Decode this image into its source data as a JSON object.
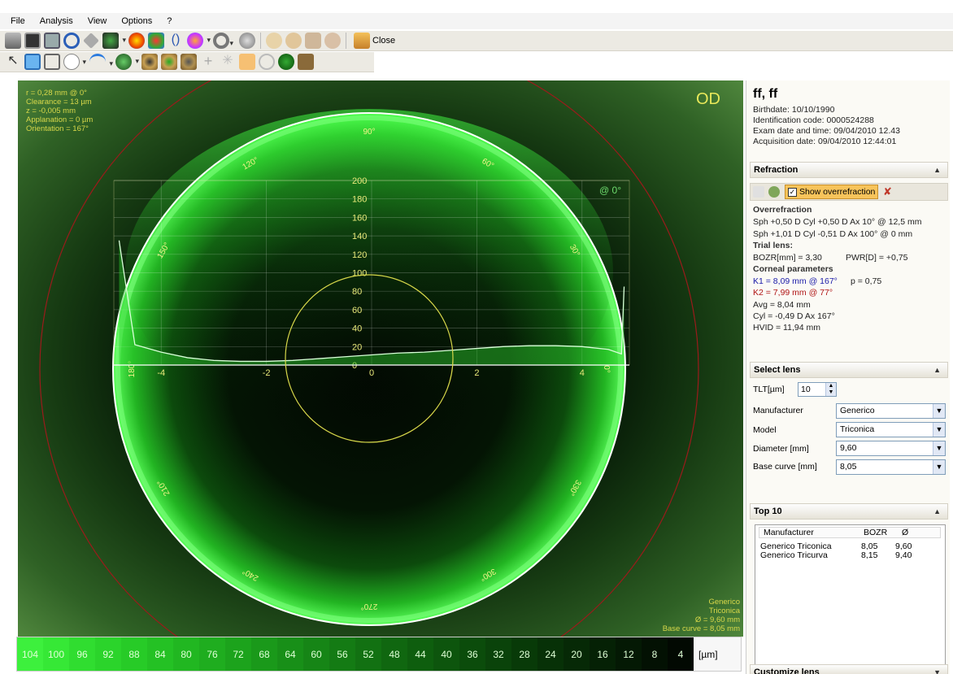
{
  "menu": [
    "File",
    "Analysis",
    "View",
    "Options",
    "?"
  ],
  "toolbar": {
    "close_label": "Close"
  },
  "overlay": {
    "info": [
      "r = 0,28 mm @ 0°",
      "Clearance = 13 µm",
      "z = -0,005 mm",
      "Applanation = 0 µm",
      "Orientation = 167°"
    ],
    "eye_label": "OD",
    "lens_info": [
      "Generico",
      "Triconica",
      "Ø = 9,60 mm",
      "Base curve = 8,05 mm"
    ],
    "angles": [
      "0°",
      "30°",
      "60°",
      "90°",
      "120°",
      "150°",
      "180°",
      "210°",
      "240°",
      "270°",
      "300°",
      "330°"
    ],
    "profile_angle": "@ 0°"
  },
  "chart_data": {
    "type": "area",
    "x": [
      -4.8,
      -4.5,
      -4,
      -3.5,
      -3,
      -2.5,
      -2,
      -1.5,
      -1,
      -0.5,
      0,
      0.5,
      1,
      1.5,
      2,
      2.5,
      3,
      3.5,
      4,
      4.5,
      4.75,
      4.8
    ],
    "y": [
      135,
      22,
      14,
      8,
      5,
      4,
      4,
      5,
      7,
      9,
      11,
      13,
      14,
      16,
      18,
      20,
      21,
      21,
      20,
      17,
      12,
      85
    ],
    "x_ticks": [
      "-4",
      "-2",
      "0",
      "2",
      "4"
    ],
    "y_ticks": [
      "0",
      "20",
      "40",
      "60",
      "80",
      "100",
      "120",
      "140",
      "160",
      "180",
      "200"
    ],
    "ylim": [
      0,
      200
    ],
    "xlim": [
      -4.9,
      4.9
    ]
  },
  "scale": {
    "values": [
      "104",
      "100",
      "96",
      "92",
      "88",
      "84",
      "80",
      "76",
      "72",
      "68",
      "64",
      "60",
      "56",
      "52",
      "48",
      "44",
      "40",
      "36",
      "32",
      "28",
      "24",
      "20",
      "16",
      "12",
      "8",
      "4"
    ],
    "colors": [
      "#3df03d",
      "#36e836",
      "#30dd30",
      "#2bd42b",
      "#27cb27",
      "#24c124",
      "#21b721",
      "#1fad1f",
      "#1ca31c",
      "#1a991a",
      "#188f18",
      "#168516",
      "#147b14",
      "#127112",
      "#106710",
      "#0e5e0e",
      "#0d550d",
      "#0b4c0b",
      "#0a430a",
      "#083a08",
      "#073107",
      "#062906",
      "#052105",
      "#041904",
      "#031103",
      "#020902"
    ],
    "unit": "[µm]"
  },
  "patient": {
    "name": "ff, ff",
    "birthdate": "Birthdate: 10/10/1990",
    "id_code": "Identification code: 0000524288",
    "exam_date": "Exam date and time: 09/04/2010 12.43",
    "acq_date": "Acquisition date: 09/04/2010 12:44:01"
  },
  "refraction": {
    "title": "Refraction",
    "show_overrefraction": "Show overrefraction",
    "overrefraction_title": "Overrefraction",
    "line1": "Sph +0,50 D Cyl +0,50 D Ax 10° @ 12,5 mm",
    "line2": "Sph +1,01 D Cyl -0,51 D Ax 100° @ 0 mm",
    "trial_title": "Trial lens:",
    "bozr": "BOZR[mm] = 3,30",
    "pwr": "PWR[D] = +0,75",
    "corneal_title": "Corneal parameters",
    "k1": "K1 = 8,09 mm @ 167°",
    "p": "p = 0,75",
    "k2": "K2 = 7,99 mm @ 77°",
    "avg": "Avg = 8,04 mm",
    "cyl": "Cyl = -0,49 D Ax 167°",
    "hvid": "HVID = 11,94  mm",
    "k1_color": "#1a1aa8",
    "k2_color": "#b01515"
  },
  "select_lens": {
    "title": "Select lens",
    "tlt_label": "TLT[µm]",
    "tlt_value": "10",
    "manufacturer_label": "Manufacturer",
    "manufacturer": "Generico",
    "model_label": "Model",
    "model": "Triconica",
    "diameter_label": "Diameter [mm]",
    "diameter": "9,60",
    "base_label": "Base curve [mm]",
    "base": "8,05"
  },
  "top10": {
    "title": "Top 10",
    "headers": [
      "Manufacturer",
      "BOZR",
      "Ø"
    ],
    "rows": [
      [
        "Generico Triconica",
        "8,05",
        "9,60"
      ],
      [
        "Generico Tricurva",
        "8,15",
        "9,40"
      ]
    ]
  },
  "customize": {
    "title": "Customize lens"
  }
}
